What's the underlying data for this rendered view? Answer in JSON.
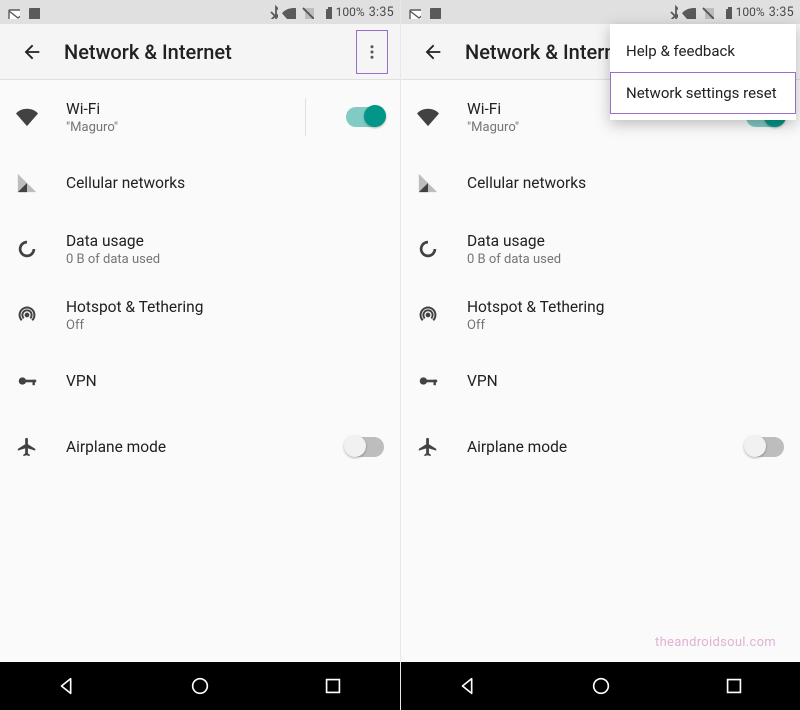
{
  "statusbar": {
    "battery_pct": "100%",
    "time": "3:35"
  },
  "toolbar": {
    "title": "Network & Internet"
  },
  "rows": {
    "wifi": {
      "title": "Wi-Fi",
      "subtitle": "\"Maguro\""
    },
    "cellular": {
      "title": "Cellular networks"
    },
    "data": {
      "title": "Data usage",
      "subtitle": "0 B of data used"
    },
    "hotspot": {
      "title": "Hotspot & Tethering",
      "subtitle": "Off"
    },
    "vpn": {
      "title": "VPN"
    },
    "airplane": {
      "title": "Airplane mode"
    }
  },
  "menu": {
    "help": "Help & feedback",
    "reset": "Network settings reset"
  },
  "watermark": "theandroidsoul.com"
}
